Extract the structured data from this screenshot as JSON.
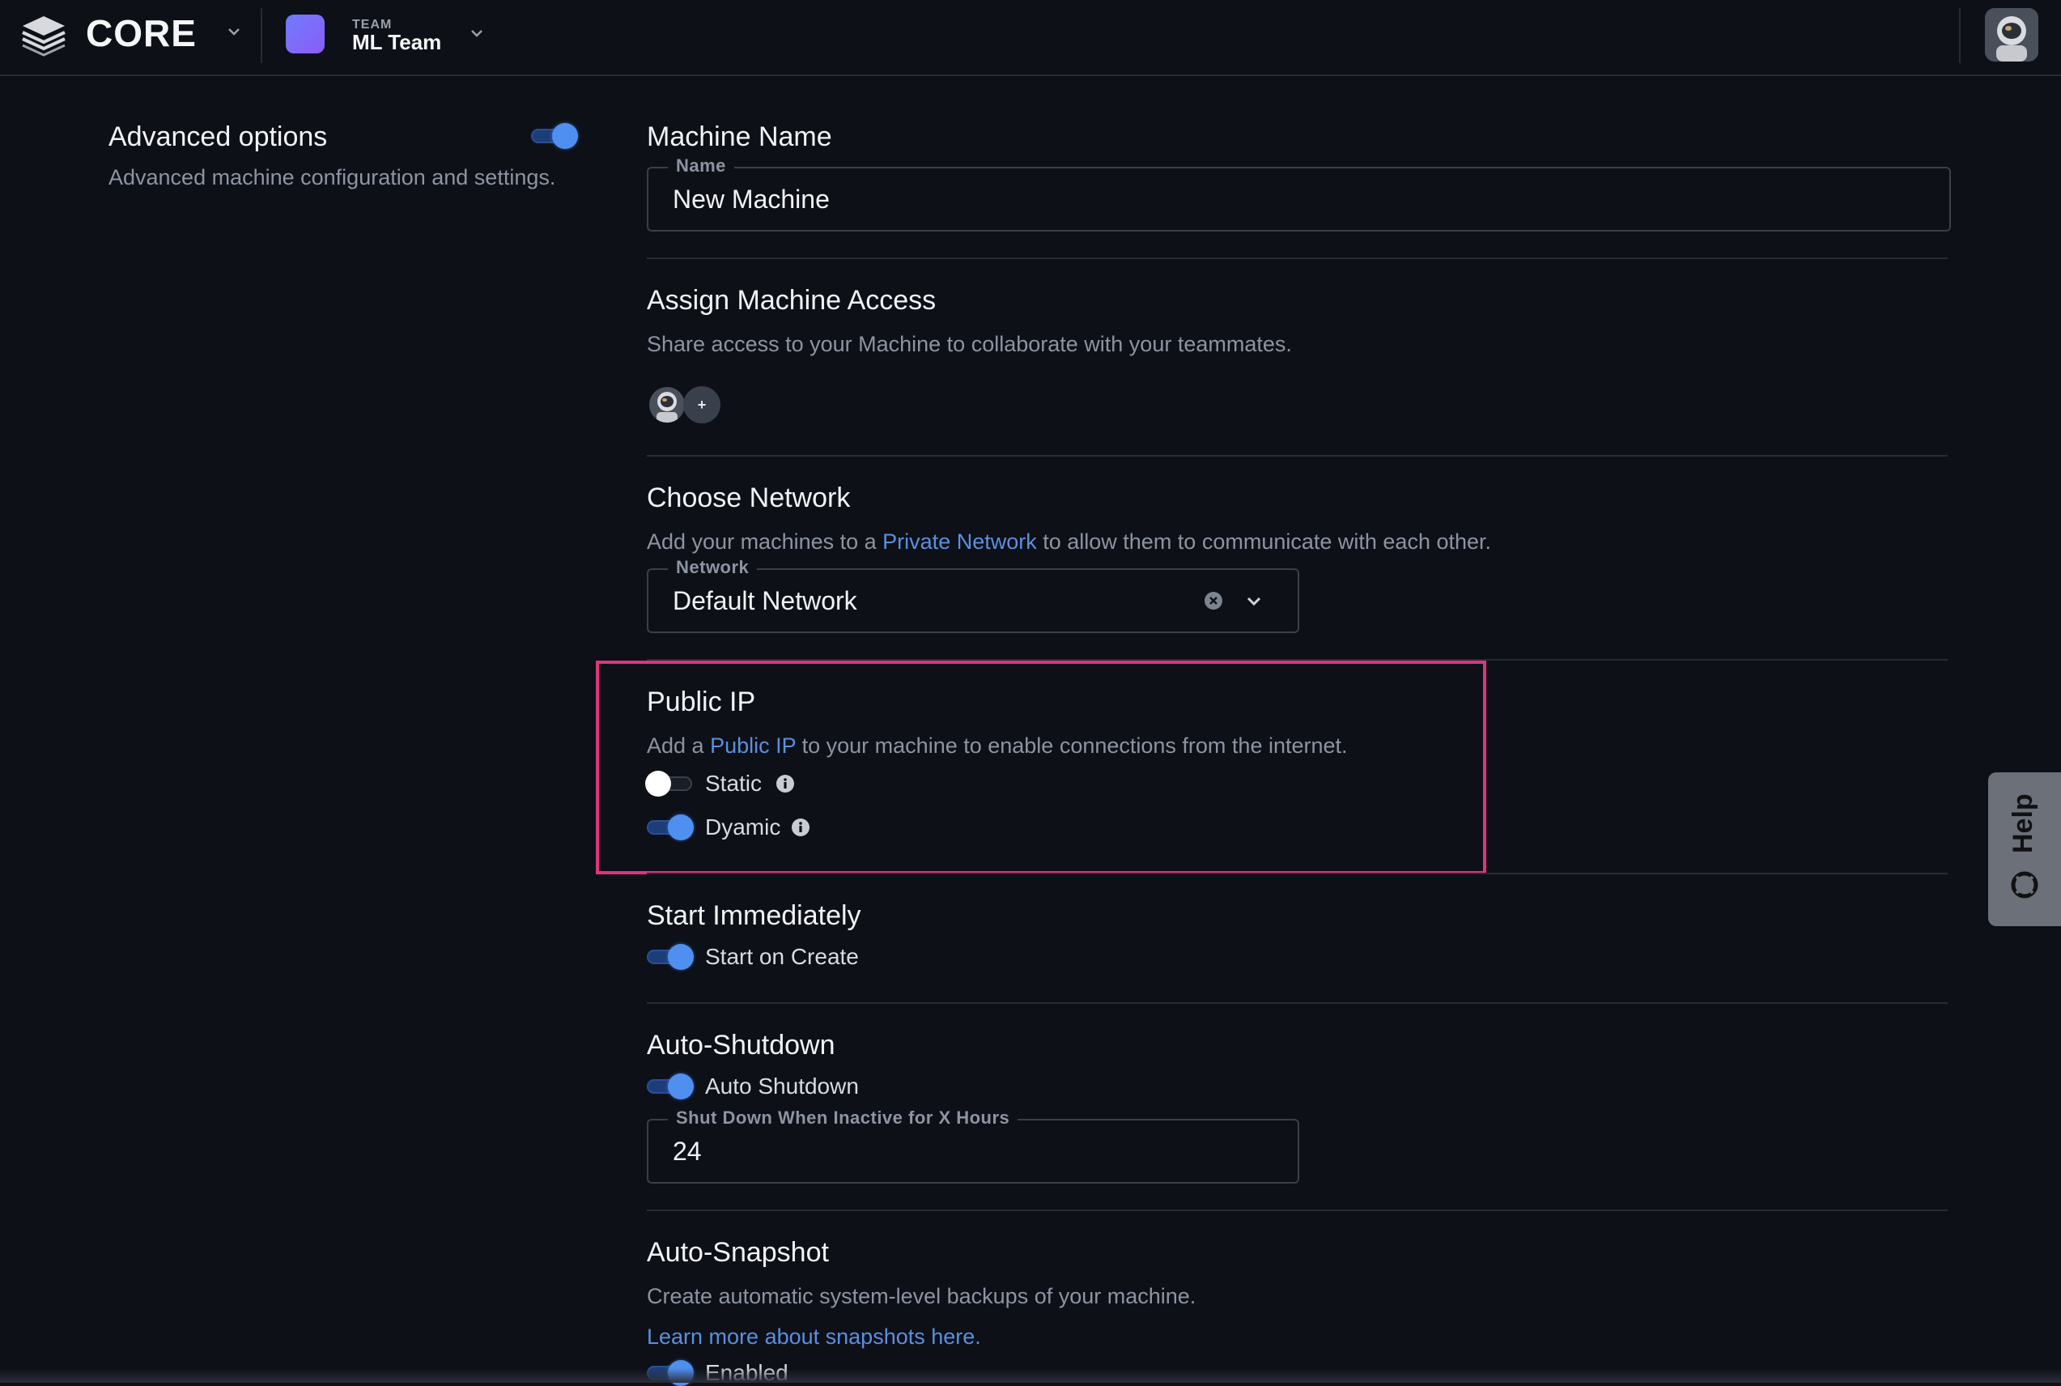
{
  "header": {
    "brand": "CORE",
    "team_label": "TEAM",
    "team_name": "ML Team"
  },
  "advanced": {
    "title": "Advanced options",
    "description": "Advanced machine configuration and settings.",
    "enabled": true
  },
  "machine_name": {
    "title": "Machine Name",
    "field_label": "Name",
    "value": "New Machine"
  },
  "access": {
    "title": "Assign Machine Access",
    "description": "Share access to your Machine to collaborate with your teammates.",
    "add_symbol": "+"
  },
  "network": {
    "title": "Choose Network",
    "desc_before": "Add your machines to a ",
    "desc_link": "Private Network",
    "desc_after": " to allow them to communicate with each other.",
    "field_label": "Network",
    "value": "Default Network"
  },
  "public_ip": {
    "title": "Public IP",
    "desc_before": "Add a ",
    "desc_link": "Public IP",
    "desc_after": " to your machine to enable connections from the internet.",
    "options": [
      {
        "label": "Static",
        "enabled": false
      },
      {
        "label": "Dyamic",
        "enabled": true
      }
    ],
    "highlight_color": "#e0337e"
  },
  "start": {
    "title": "Start Immediately",
    "option_label": "Start on Create",
    "enabled": true
  },
  "shutdown": {
    "title": "Auto-Shutdown",
    "option_label": "Auto Shutdown",
    "enabled": true,
    "field_label": "Shut Down When Inactive for X Hours",
    "value": "24"
  },
  "snapshot": {
    "title": "Auto-Snapshot",
    "description": "Create automatic system-level backups of your machine.",
    "link": "Learn more about snapshots here.",
    "option_label": "Enabled",
    "enabled": true
  },
  "help": {
    "label": "Help"
  },
  "colors": {
    "background": "#0d1017",
    "accent": "#4f8ff0",
    "link": "#5b8fe0",
    "highlight": "#e0337e"
  }
}
